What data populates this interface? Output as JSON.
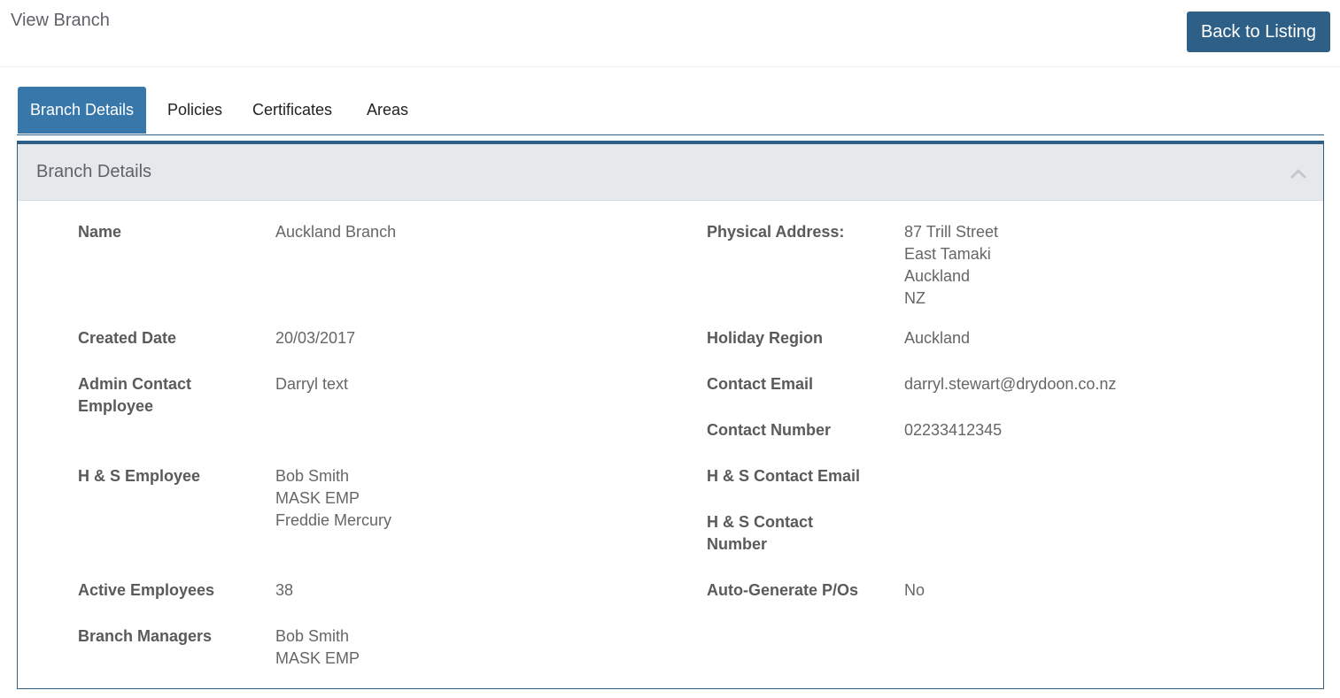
{
  "header": {
    "title": "View Branch",
    "back_label": "Back to Listing"
  },
  "tabs": [
    {
      "label": "Branch Details",
      "active": true
    },
    {
      "label": "Policies",
      "active": false
    },
    {
      "label": "Certificates",
      "active": false
    },
    {
      "label": "Areas",
      "active": false
    }
  ],
  "panel": {
    "title": "Branch Details",
    "collapse_icon": "chevron-up-icon"
  },
  "left_fields": {
    "name": {
      "label": "Name",
      "value": "Auckland Branch"
    },
    "created_date": {
      "label": "Created Date",
      "value": "20/03/2017"
    },
    "admin_contact": {
      "label_line1": "Admin Contact",
      "label_line2": "Employee",
      "value": "Darryl text"
    },
    "hs_employee": {
      "label": "H & S Employee",
      "values": [
        "Bob Smith",
        "MASK EMP",
        "Freddie Mercury"
      ]
    },
    "active_employees": {
      "label": "Active Employees",
      "value": "38"
    },
    "branch_managers": {
      "label": "Branch Managers",
      "values": [
        "Bob Smith",
        "MASK EMP"
      ]
    }
  },
  "right_fields": {
    "physical_address": {
      "label": "Physical Address:",
      "lines": [
        "87 Trill Street",
        "East Tamaki",
        "Auckland",
        "NZ"
      ]
    },
    "holiday_region": {
      "label": "Holiday Region",
      "value": "Auckland"
    },
    "contact_email": {
      "label": "Contact Email",
      "value": "darryl.stewart@drydoon.co.nz"
    },
    "contact_number": {
      "label": "Contact Number",
      "value": "02233412345"
    },
    "hs_contact_email": {
      "label": "H & S Contact Email",
      "value": ""
    },
    "hs_contact_number": {
      "label_line1": "H & S Contact",
      "label_line2": "Number",
      "value": ""
    },
    "auto_generate_pos": {
      "label": "Auto-Generate P/Os",
      "value": "No"
    }
  },
  "colors": {
    "primary": "#2e5f86",
    "tab_active": "#3777aa",
    "panel_header": "#e6e9ec"
  }
}
